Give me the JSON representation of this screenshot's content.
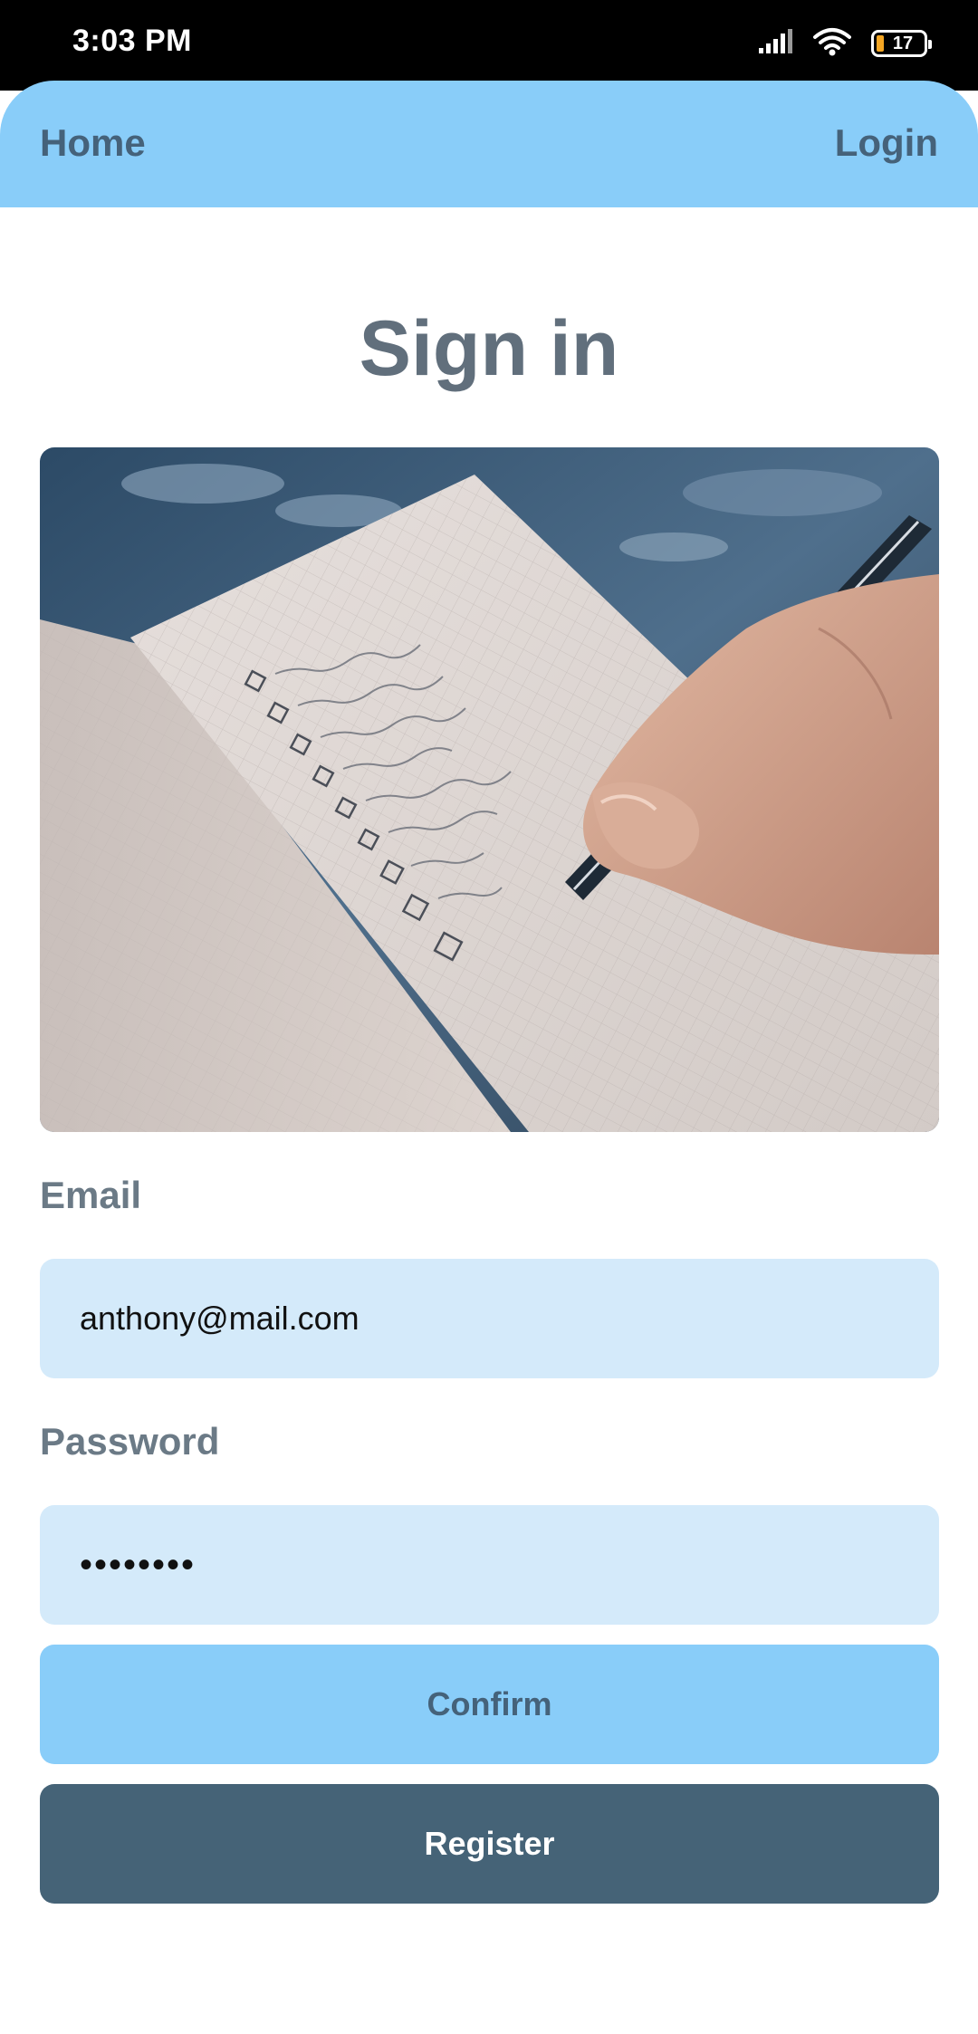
{
  "status_bar": {
    "time": "3:03 PM",
    "battery_level": "17"
  },
  "app_bar": {
    "home_label": "Home",
    "login_label": "Login"
  },
  "page": {
    "title": "Sign in"
  },
  "hero_image": {
    "subject": "hand writing checklist in notebook"
  },
  "form": {
    "email_label": "Email",
    "email_value": "anthony@mail.com",
    "password_label": "Password",
    "password_value": "••••••••"
  },
  "buttons": {
    "confirm_label": "Confirm",
    "register_label": "Register"
  },
  "colors": {
    "app_bar": "#89cdf9",
    "nav_text": "#45627a",
    "title_text": "#616f7c",
    "input_bg": "#d4eafa",
    "confirm_bg": "#89cdf9",
    "register_bg": "#456377"
  }
}
